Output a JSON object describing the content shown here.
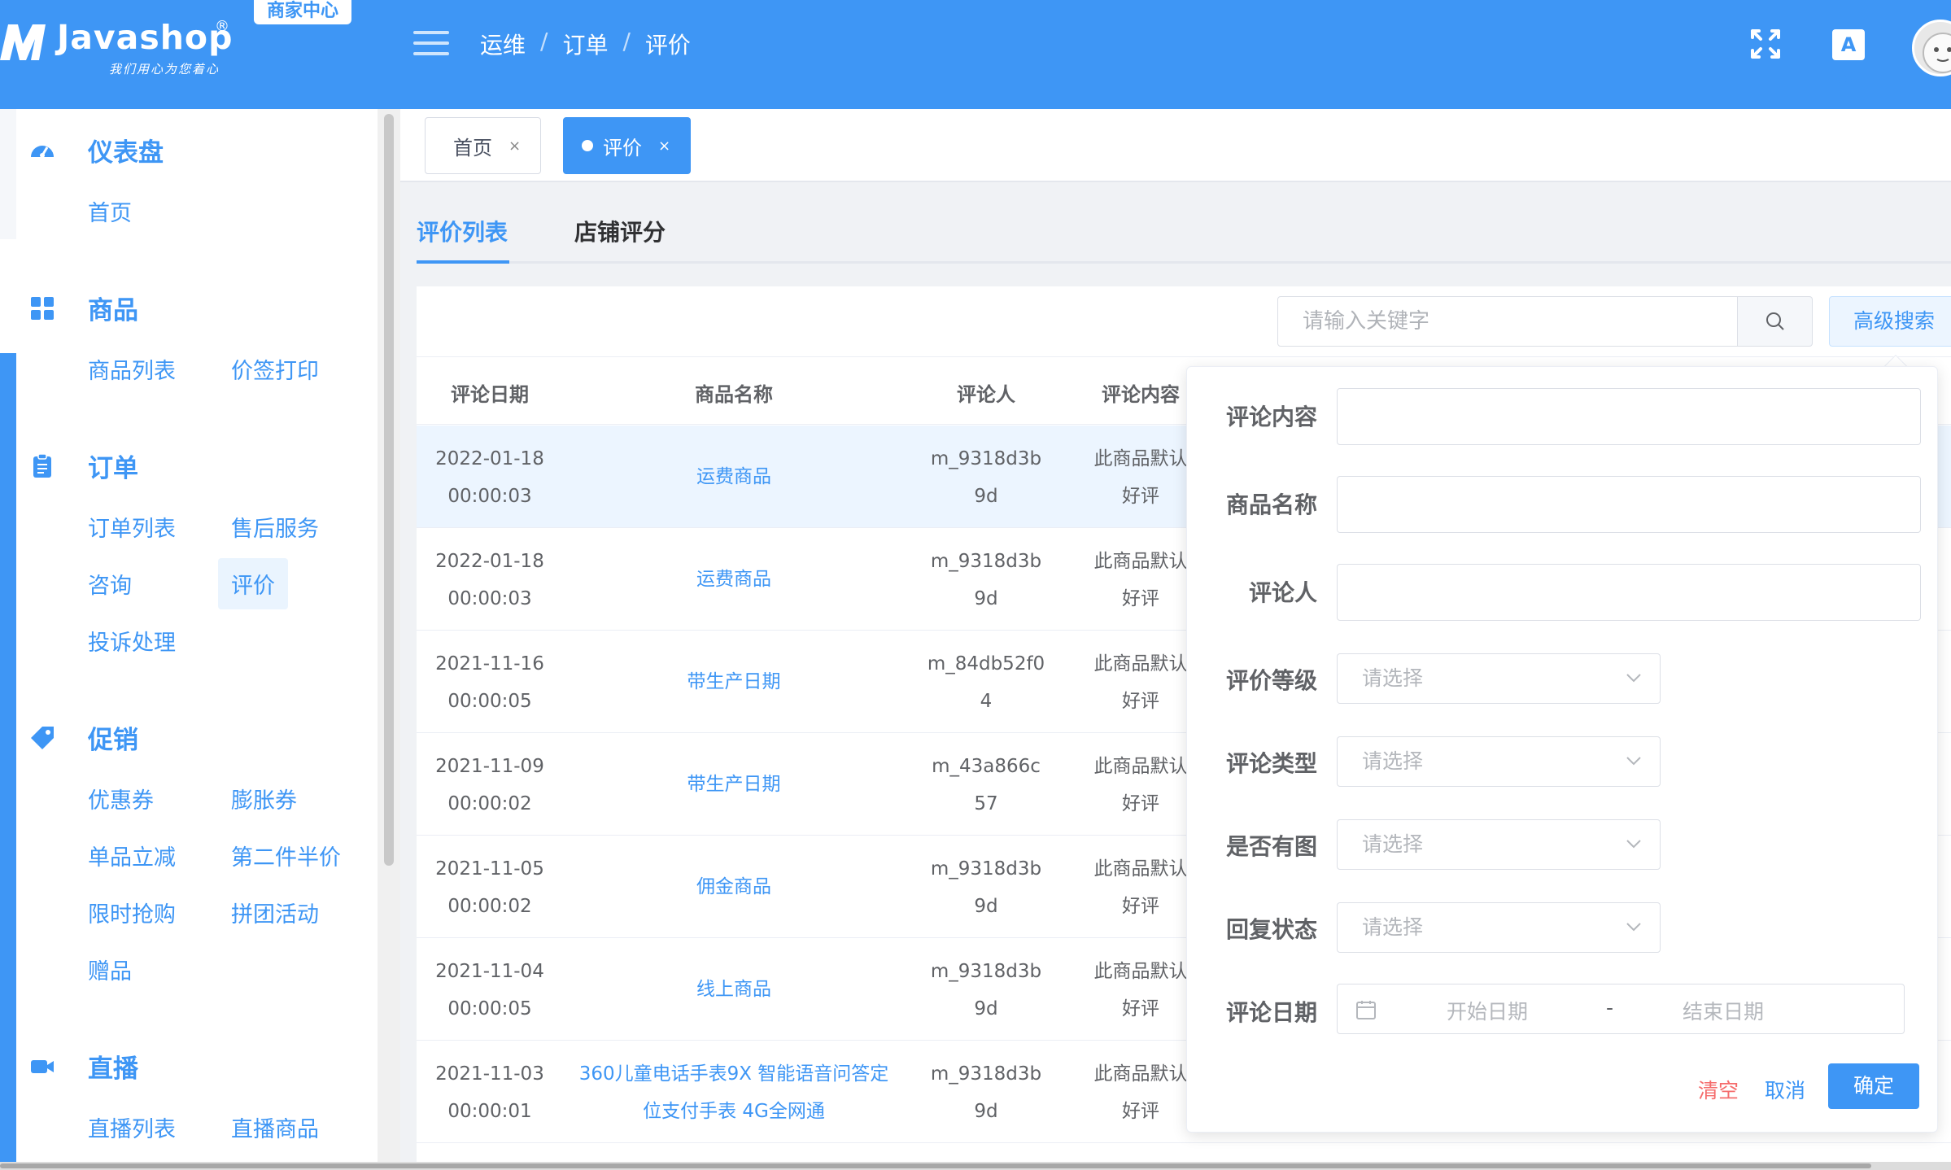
{
  "header": {
    "logo_text": "Javashop",
    "logo_reg": "®",
    "logo_slogan": "我们用心为您着心",
    "merchant_badge": "商家中心",
    "breadcrumb": [
      "运维",
      "订单",
      "评价"
    ],
    "lang_label": "A文"
  },
  "sidebar": {
    "groups": [
      {
        "title": "仪表盘",
        "icon": "dashboard-icon",
        "items": [
          "首页"
        ]
      },
      {
        "title": "商品",
        "icon": "grid-icon",
        "items": [
          "商品列表",
          "价签打印"
        ]
      },
      {
        "title": "订单",
        "icon": "clipboard-icon",
        "items": [
          "订单列表",
          "售后服务",
          "咨询",
          "评价",
          "投诉处理"
        ]
      },
      {
        "title": "促销",
        "icon": "tag-icon",
        "items": [
          "优惠券",
          "膨胀券",
          "单品立减",
          "第二件半价",
          "限时抢购",
          "拼团活动",
          "赠品"
        ]
      },
      {
        "title": "直播",
        "icon": "video-icon",
        "items": [
          "直播列表",
          "直播商品"
        ]
      }
    ],
    "active_item": "评价"
  },
  "tags": [
    {
      "label": "首页",
      "active": false
    },
    {
      "label": "评价",
      "active": true
    }
  ],
  "tabs": [
    "评价列表",
    "店铺评分"
  ],
  "search": {
    "placeholder": "请输入关键字",
    "advanced_label": "高级搜索"
  },
  "table": {
    "columns": [
      "评论日期",
      "商品名称",
      "评论人",
      "评论内容"
    ],
    "rows": [
      {
        "date": "2022-01-18",
        "time": "00:00:03",
        "goods": [
          "运费商品"
        ],
        "user1": "m_9318d3b",
        "user2": "9d",
        "content1": "此商品默认",
        "content2": "好评"
      },
      {
        "date": "2022-01-18",
        "time": "00:00:03",
        "goods": [
          "运费商品"
        ],
        "user1": "m_9318d3b",
        "user2": "9d",
        "content1": "此商品默认",
        "content2": "好评"
      },
      {
        "date": "2021-11-16",
        "time": "00:00:05",
        "goods": [
          "带生产日期"
        ],
        "user1": "m_84db52f0",
        "user2": "4",
        "content1": "此商品默认",
        "content2": "好评"
      },
      {
        "date": "2021-11-09",
        "time": "00:00:02",
        "goods": [
          "带生产日期"
        ],
        "user1": "m_43a866c",
        "user2": "57",
        "content1": "此商品默认",
        "content2": "好评"
      },
      {
        "date": "2021-11-05",
        "time": "00:00:02",
        "goods": [
          "佣金商品"
        ],
        "user1": "m_9318d3b",
        "user2": "9d",
        "content1": "此商品默认",
        "content2": "好评"
      },
      {
        "date": "2021-11-04",
        "time": "00:00:05",
        "goods": [
          "线上商品"
        ],
        "user1": "m_9318d3b",
        "user2": "9d",
        "content1": "此商品默认",
        "content2": "好评"
      },
      {
        "date": "2021-11-03",
        "time": "00:00:01",
        "goods": [
          "360儿童电话手表9X 智能语音问答定",
          "位支付手表 4G全网通"
        ],
        "user1": "m_9318d3b",
        "user2": "9d",
        "content1": "此商品默认",
        "content2": "好评"
      }
    ]
  },
  "advanced_search": {
    "fields": {
      "content_label": "评论内容",
      "goods_label": "商品名称",
      "member_label": "评论人",
      "grade_label": "评价等级",
      "type_label": "评论类型",
      "image_label": "是否有图",
      "reply_label": "回复状态",
      "date_label": "评论日期"
    },
    "select_placeholder": "请选择",
    "start_date": "开始日期",
    "end_date": "结束日期",
    "date_sep": "-",
    "clear_label": "清空",
    "cancel_label": "取消",
    "confirm_label": "确定"
  },
  "colors": {
    "primary": "#3e96f5",
    "danger": "#f56c6c"
  }
}
